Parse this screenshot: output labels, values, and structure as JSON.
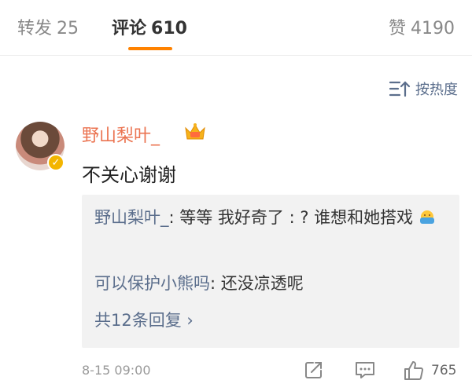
{
  "tabs": [
    {
      "label": "转发",
      "count": "25"
    },
    {
      "label": "评论",
      "count": "610"
    },
    {
      "label": "赞",
      "count": "4190"
    }
  ],
  "sort": {
    "label": "按热度"
  },
  "comment": {
    "username": "野山梨叶_",
    "text": "不关心谢谢",
    "time": "8-15 09:00",
    "like_count": "765",
    "replies": [
      {
        "name": "野山梨叶_",
        "text": ": 等等 我好奇了 : ? 谁想和她搭戏"
      },
      {
        "name": "可以保护小熊吗",
        "text": ": 还没凉透呢"
      }
    ],
    "more_replies": "共12条回复 ›"
  },
  "colors": {
    "accent": "#ff8200",
    "link": "#5b6e8c",
    "username": "#eb7350"
  },
  "icons": [
    "sort-icon",
    "crown-icon",
    "verified-icon",
    "emoji-icon",
    "repost-icon",
    "reply-icon",
    "like-icon"
  ]
}
